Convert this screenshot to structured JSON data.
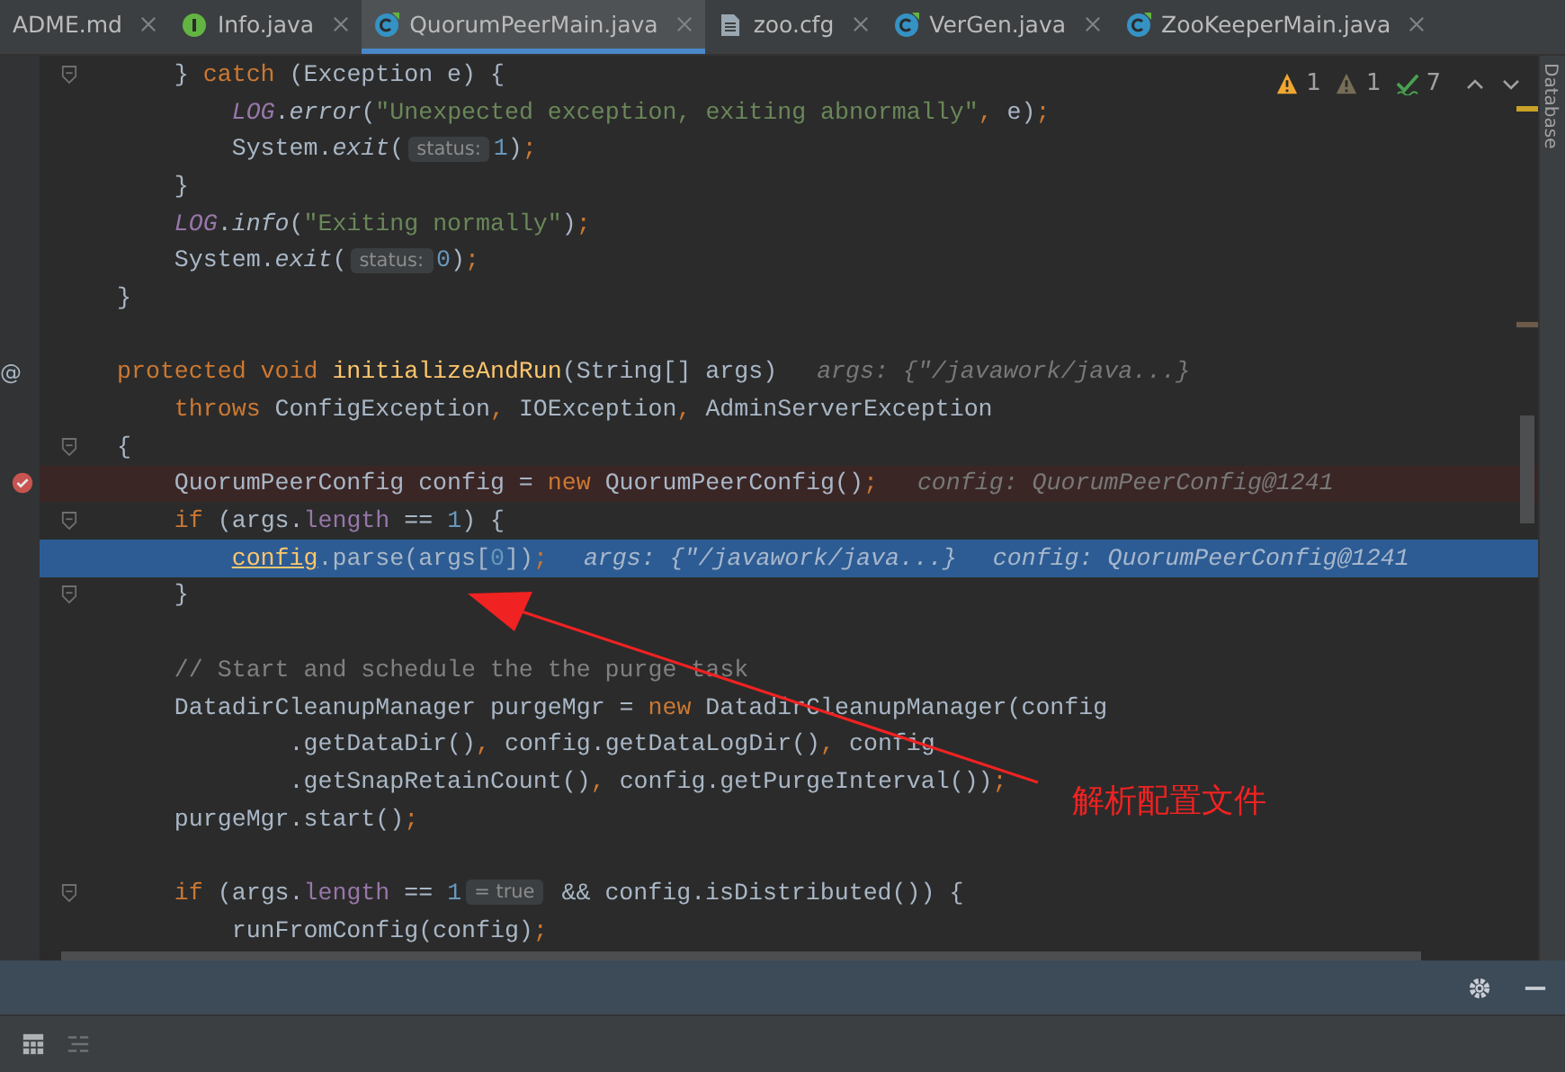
{
  "tabs": [
    {
      "label": "ADME.md",
      "kind": "none",
      "selected": false
    },
    {
      "label": "Info.java",
      "kind": "interface",
      "selected": false
    },
    {
      "label": "QuorumPeerMain.java",
      "kind": "class",
      "selected": true
    },
    {
      "label": "zoo.cfg",
      "kind": "file",
      "selected": false
    },
    {
      "label": "VerGen.java",
      "kind": "class",
      "selected": false
    },
    {
      "label": "ZooKeeperMain.java",
      "kind": "class",
      "selected": false
    }
  ],
  "inspections": [
    {
      "kind": "warning",
      "count": "1"
    },
    {
      "kind": "weak",
      "count": "1"
    },
    {
      "kind": "typo",
      "count": "7"
    }
  ],
  "side_tool": "Database",
  "lines": [
    {
      "kind": "normal",
      "gutter": {
        "kind": "fold"
      },
      "segments": [
        {
          "kind": "code",
          "tokens": [
            {
              "kind": "plain",
              "text": "    } "
            },
            {
              "kind": "keyword",
              "text": "catch"
            },
            {
              "kind": "plain",
              "text": " (Exception e) {"
            }
          ]
        }
      ]
    },
    {
      "kind": "normal",
      "segments": [
        {
          "kind": "code",
          "tokens": [
            {
              "kind": "static",
              "text": "        LOG"
            },
            {
              "kind": "plain",
              "text": "."
            },
            {
              "kind": "call",
              "text": "error"
            },
            {
              "kind": "plain",
              "text": "("
            },
            {
              "kind": "string",
              "text": "\"Unexpected exception, exiting abnormally\""
            },
            {
              "kind": "keyword",
              "text": ","
            },
            {
              "kind": "plain",
              "text": " e)"
            },
            {
              "kind": "keyword",
              "text": ";"
            }
          ]
        }
      ]
    },
    {
      "kind": "normal",
      "segments": [
        {
          "kind": "code",
          "tokens": [
            {
              "kind": "plain",
              "text": "        System."
            },
            {
              "kind": "call",
              "text": "exit"
            },
            {
              "kind": "plain",
              "text": "("
            }
          ]
        },
        {
          "kind": "inlay",
          "text": "status:"
        },
        {
          "kind": "code",
          "tokens": [
            {
              "kind": "number",
              "text": "1"
            },
            {
              "kind": "plain",
              "text": ")"
            },
            {
              "kind": "keyword",
              "text": ";"
            }
          ]
        }
      ]
    },
    {
      "kind": "normal",
      "segments": [
        {
          "kind": "code",
          "tokens": [
            {
              "kind": "plain",
              "text": "    }"
            }
          ]
        }
      ]
    },
    {
      "kind": "normal",
      "segments": [
        {
          "kind": "code",
          "tokens": [
            {
              "kind": "static",
              "text": "    LOG"
            },
            {
              "kind": "plain",
              "text": "."
            },
            {
              "kind": "call",
              "text": "info"
            },
            {
              "kind": "plain",
              "text": "("
            },
            {
              "kind": "string",
              "text": "\"Exiting normally\""
            },
            {
              "kind": "plain",
              "text": ")"
            },
            {
              "kind": "keyword",
              "text": ";"
            }
          ]
        }
      ]
    },
    {
      "kind": "normal",
      "segments": [
        {
          "kind": "code",
          "tokens": [
            {
              "kind": "plain",
              "text": "    System."
            },
            {
              "kind": "call",
              "text": "exit"
            },
            {
              "kind": "plain",
              "text": "("
            }
          ]
        },
        {
          "kind": "inlay",
          "text": "status:"
        },
        {
          "kind": "code",
          "tokens": [
            {
              "kind": "number",
              "text": "0"
            },
            {
              "kind": "plain",
              "text": ")"
            },
            {
              "kind": "keyword",
              "text": ";"
            }
          ]
        }
      ]
    },
    {
      "kind": "normal",
      "segments": [
        {
          "kind": "code",
          "tokens": [
            {
              "kind": "plain",
              "text": "}"
            }
          ]
        }
      ]
    },
    {
      "kind": "normal"
    },
    {
      "kind": "normal",
      "gutter": {
        "kind": "override",
        "symbol": "@"
      },
      "segments": [
        {
          "kind": "code",
          "tokens": [
            {
              "kind": "keyword",
              "text": "protected void "
            },
            {
              "kind": "declaration",
              "text": "initializeAndRun"
            },
            {
              "kind": "plain",
              "text": "(String[] args)"
            }
          ]
        },
        {
          "kind": "value",
          "text": "args: {\"/javawork/java...}"
        }
      ]
    },
    {
      "kind": "normal",
      "segments": [
        {
          "kind": "code",
          "tokens": [
            {
              "kind": "keyword",
              "text": "    throws "
            },
            {
              "kind": "plain",
              "text": "ConfigException"
            },
            {
              "kind": "keyword",
              "text": ","
            },
            {
              "kind": "plain",
              "text": " IOException"
            },
            {
              "kind": "keyword",
              "text": ","
            },
            {
              "kind": "plain",
              "text": " AdminServerException"
            }
          ]
        }
      ]
    },
    {
      "kind": "normal",
      "gutter": {
        "kind": "fold"
      },
      "segments": [
        {
          "kind": "code",
          "tokens": [
            {
              "kind": "plain",
              "text": "{"
            }
          ]
        }
      ]
    },
    {
      "kind": "breakpoint",
      "gutter": {
        "kind": "breakpoint"
      },
      "segments": [
        {
          "kind": "code",
          "tokens": [
            {
              "kind": "plain",
              "text": "    QuorumPeerConfig config = "
            },
            {
              "kind": "keyword",
              "text": "new "
            },
            {
              "kind": "plain",
              "text": "QuorumPeerConfig()"
            },
            {
              "kind": "keyword",
              "text": ";"
            }
          ]
        },
        {
          "kind": "value",
          "text": "config: QuorumPeerConfig@1241"
        }
      ]
    },
    {
      "kind": "normal",
      "gutter": {
        "kind": "fold"
      },
      "segments": [
        {
          "kind": "code",
          "tokens": [
            {
              "kind": "keyword",
              "text": "    if "
            },
            {
              "kind": "plain",
              "text": "(args."
            },
            {
              "kind": "field",
              "text": "length"
            },
            {
              "kind": "plain",
              "text": " == "
            },
            {
              "kind": "number",
              "text": "1"
            },
            {
              "kind": "plain",
              "text": ") {"
            }
          ]
        }
      ]
    },
    {
      "kind": "execution",
      "segments": [
        {
          "kind": "code",
          "tokens": [
            {
              "kind": "usage",
              "text": "        config"
            },
            {
              "kind": "plain",
              "text": ".parse(args["
            },
            {
              "kind": "number",
              "text": "0"
            },
            {
              "kind": "plain",
              "text": "])"
            },
            {
              "kind": "keyword",
              "text": ";"
            }
          ]
        },
        {
          "kind": "value",
          "text": "args: {\"/javawork/java...}"
        },
        {
          "kind": "value",
          "text": "config: QuorumPeerConfig@1241"
        }
      ]
    },
    {
      "kind": "normal",
      "gutter": {
        "kind": "fold"
      },
      "segments": [
        {
          "kind": "code",
          "tokens": [
            {
              "kind": "plain",
              "text": "    }"
            }
          ]
        }
      ]
    },
    {
      "kind": "normal"
    },
    {
      "kind": "normal",
      "segments": [
        {
          "kind": "code",
          "tokens": [
            {
              "kind": "comment",
              "text": "    // Start and schedule the the purge task"
            }
          ]
        }
      ]
    },
    {
      "kind": "normal",
      "segments": [
        {
          "kind": "code",
          "tokens": [
            {
              "kind": "plain",
              "text": "    DatadirCleanupManager purgeMgr = "
            },
            {
              "kind": "keyword",
              "text": "new "
            },
            {
              "kind": "plain",
              "text": "DatadirCleanupManager(config"
            }
          ]
        }
      ]
    },
    {
      "kind": "normal",
      "segments": [
        {
          "kind": "code",
          "tokens": [
            {
              "kind": "plain",
              "text": "            .getDataDir()"
            },
            {
              "kind": "keyword",
              "text": ","
            },
            {
              "kind": "plain",
              "text": " config.getDataLogDir()"
            },
            {
              "kind": "keyword",
              "text": ","
            },
            {
              "kind": "plain",
              "text": " config"
            }
          ]
        }
      ]
    },
    {
      "kind": "normal",
      "segments": [
        {
          "kind": "code",
          "tokens": [
            {
              "kind": "plain",
              "text": "            .getSnapRetainCount()"
            },
            {
              "kind": "keyword",
              "text": ","
            },
            {
              "kind": "plain",
              "text": " config.getPurgeInterval())"
            },
            {
              "kind": "keyword",
              "text": ";"
            }
          ]
        }
      ]
    },
    {
      "kind": "normal",
      "segments": [
        {
          "kind": "code",
          "tokens": [
            {
              "kind": "plain",
              "text": "    purgeMgr.start()"
            },
            {
              "kind": "keyword",
              "text": ";"
            }
          ]
        }
      ]
    },
    {
      "kind": "normal"
    },
    {
      "kind": "normal",
      "gutter": {
        "kind": "fold"
      },
      "segments": [
        {
          "kind": "code",
          "tokens": [
            {
              "kind": "keyword",
              "text": "    if "
            },
            {
              "kind": "plain",
              "text": "(args."
            },
            {
              "kind": "field",
              "text": "length"
            },
            {
              "kind": "plain",
              "text": " == "
            },
            {
              "kind": "number",
              "text": "1"
            }
          ]
        },
        {
          "kind": "inlay",
          "text": "= true"
        },
        {
          "kind": "code",
          "tokens": [
            {
              "kind": "plain",
              "text": " && config.isDistributed()) {"
            }
          ]
        }
      ]
    },
    {
      "kind": "normal",
      "segments": [
        {
          "kind": "code",
          "tokens": [
            {
              "kind": "plain",
              "text": "        runFromConfig(config)"
            },
            {
              "kind": "keyword",
              "text": ";"
            }
          ]
        }
      ]
    }
  ],
  "annotation": {
    "text": "解析配置文件"
  }
}
